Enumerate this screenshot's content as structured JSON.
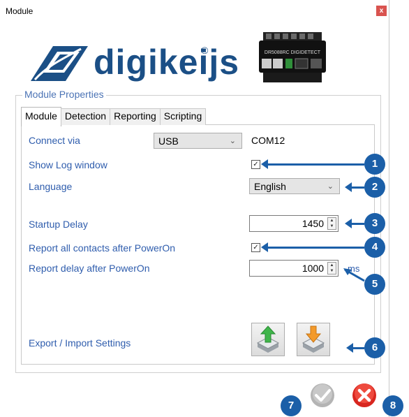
{
  "window": {
    "title": "Module",
    "close_glyph": "x"
  },
  "logo": {
    "brand": "digikeijs",
    "registered": "®"
  },
  "device": {
    "label": "DR5088RC DIGIDETECT"
  },
  "group": {
    "title": "Module Properties"
  },
  "tabs": [
    "Module",
    "Detection",
    "Reporting",
    "Scripting"
  ],
  "form": {
    "connect_label": "Connect via",
    "connect_value": "USB",
    "com_port": "COM12",
    "show_log_label": "Show Log window",
    "language_label": "Language",
    "language_value": "English",
    "startup_label": "Startup Delay",
    "startup_value": "1450",
    "report_contacts_label": "Report all contacts after PowerOn",
    "report_delay_label": "Report delay after PowerOn",
    "report_delay_value": "1000",
    "report_delay_unit": "ms",
    "export_label": "Export / Import Settings"
  },
  "callouts": [
    "1",
    "2",
    "3",
    "4",
    "5",
    "6",
    "7",
    "8"
  ],
  "icons": {
    "export": "green-up-arrow-icon",
    "import": "orange-down-arrow-icon",
    "ok": "checkmark-icon",
    "cancel": "cross-icon"
  },
  "colors": {
    "accent": "#1b5fa8",
    "label": "#2f5dad",
    "brand": "#1b4f86"
  }
}
